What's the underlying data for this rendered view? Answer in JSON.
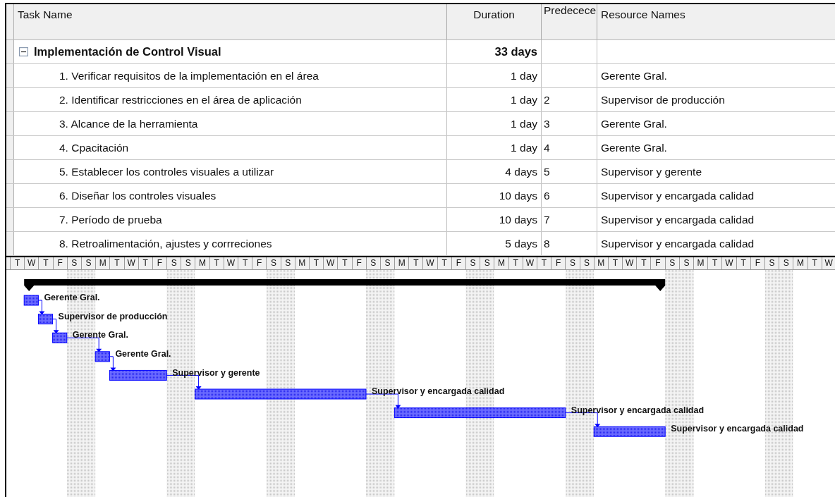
{
  "table": {
    "columns": [
      "Task Name",
      "Duration",
      "Predecece",
      "Resource Names"
    ],
    "summary": {
      "name": "Implementación de Control Visual",
      "duration": "33 days",
      "expanded": true
    },
    "tasks": [
      {
        "name": "1. Verificar requisitos de la implementación en el área",
        "duration": "1 day",
        "resources": "Gerente Gral."
      },
      {
        "name": "2. Identificar restricciones en el área de aplicación",
        "duration": "1 day",
        "predecessors": "2",
        "resources": "Supervisor de producción"
      },
      {
        "name": "3. Alcance de la herramienta",
        "duration": "1 day",
        "predecessors": "3",
        "resources": "Gerente Gral."
      },
      {
        "name": "4. Cpacitación",
        "duration": "1 day",
        "predecessors": "4",
        "resources": "Gerente Gral."
      },
      {
        "name": "5. Establecer los controles visuales a utilizar",
        "duration": "4 days",
        "predecessors": "5",
        "resources": "Supervisor y gerente"
      },
      {
        "name": "6. Diseñar los controles visuales",
        "duration": "10 days",
        "predecessors": "6",
        "resources": "Supervisor y encargada calidad"
      },
      {
        "name": "7. Período de prueba",
        "duration": "10 days",
        "predecessors": "7",
        "resources": "Supervisor y encargada calidad"
      },
      {
        "name": "8. Retroalimentación, ajustes y corrreciones",
        "duration": "5 days",
        "predecessors": "8",
        "resources": "Supervisor y encargada calidad"
      }
    ]
  },
  "gantt": {
    "bar_labels": [
      "Gerente Gral.",
      "Supervisor de producción",
      "Gerente Gral.",
      "Gerente Gral.",
      "Supervisor y gerente",
      "Supervisor y encargada calidad",
      "Supervisor y encargada calidad",
      "Supervisor y encargada calidad"
    ],
    "days": [
      {
        "label": "T",
        "weekend": false
      },
      {
        "label": "W",
        "weekend": false
      },
      {
        "label": "T",
        "weekend": false
      },
      {
        "label": "F",
        "weekend": false
      },
      {
        "label": "S",
        "weekend": true
      },
      {
        "label": "S",
        "weekend": true
      },
      {
        "label": "M",
        "weekend": false
      },
      {
        "label": "T",
        "weekend": false
      },
      {
        "label": "W",
        "weekend": false
      },
      {
        "label": "T",
        "weekend": false
      },
      {
        "label": "F",
        "weekend": false
      },
      {
        "label": "S",
        "weekend": true
      },
      {
        "label": "S",
        "weekend": true
      },
      {
        "label": "M",
        "weekend": false
      },
      {
        "label": "T",
        "weekend": false
      },
      {
        "label": "W",
        "weekend": false
      },
      {
        "label": "T",
        "weekend": false
      },
      {
        "label": "F",
        "weekend": false
      },
      {
        "label": "S",
        "weekend": true
      },
      {
        "label": "S",
        "weekend": true
      },
      {
        "label": "M",
        "weekend": false
      },
      {
        "label": "T",
        "weekend": false
      },
      {
        "label": "W",
        "weekend": false
      },
      {
        "label": "T",
        "weekend": false
      },
      {
        "label": "F",
        "weekend": false
      },
      {
        "label": "S",
        "weekend": true
      },
      {
        "label": "S",
        "weekend": true
      },
      {
        "label": "M",
        "weekend": false
      },
      {
        "label": "T",
        "weekend": false
      },
      {
        "label": "W",
        "weekend": false
      },
      {
        "label": "T",
        "weekend": false
      },
      {
        "label": "F",
        "weekend": false
      },
      {
        "label": "S",
        "weekend": true
      },
      {
        "label": "S",
        "weekend": true
      },
      {
        "label": "M",
        "weekend": false
      },
      {
        "label": "T",
        "weekend": false
      },
      {
        "label": "W",
        "weekend": false
      },
      {
        "label": "T",
        "weekend": false
      },
      {
        "label": "F",
        "weekend": false
      },
      {
        "label": "S",
        "weekend": true
      },
      {
        "label": "S",
        "weekend": true
      },
      {
        "label": "M",
        "weekend": false
      },
      {
        "label": "T",
        "weekend": false
      },
      {
        "label": "W",
        "weekend": false
      },
      {
        "label": "T",
        "weekend": false
      },
      {
        "label": "F",
        "weekend": false
      },
      {
        "label": "S",
        "weekend": true
      },
      {
        "label": "S",
        "weekend": true
      },
      {
        "label": "M",
        "weekend": false
      },
      {
        "label": "T",
        "weekend": false
      },
      {
        "label": "W",
        "weekend": false
      },
      {
        "label": "T",
        "weekend": false
      },
      {
        "label": "F",
        "weekend": false
      },
      {
        "label": "S",
        "weekend": true
      },
      {
        "label": "S",
        "weekend": true
      },
      {
        "label": "M",
        "weekend": false
      },
      {
        "label": "T",
        "weekend": false
      },
      {
        "label": "W",
        "weekend": false
      }
    ]
  }
}
